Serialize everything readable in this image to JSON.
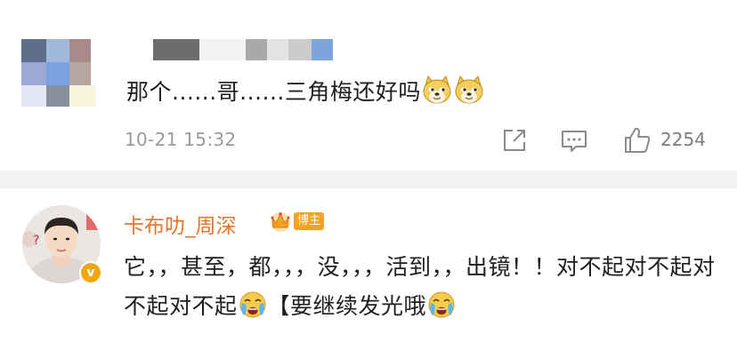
{
  "comment_1": {
    "text": "那个......哥......三角梅还好吗",
    "emoji": [
      "doge-emoji",
      "doge-emoji"
    ],
    "time": "10-21 15:32",
    "likes": "2254"
  },
  "comment_2": {
    "username": "卡布叻_周深",
    "host_badge": "博主",
    "verified_badge": "v",
    "text_part1": "它，，甚至，都，，，没，，，活到，，出镜！！对不起对不起对不起对不起",
    "text_part2": "【要继续发光哦"
  },
  "colors": {
    "username": "#e8742c",
    "host_badge": "#f3a224",
    "divider": "#f2f2f2",
    "meta_text": "#9a9a9a"
  }
}
